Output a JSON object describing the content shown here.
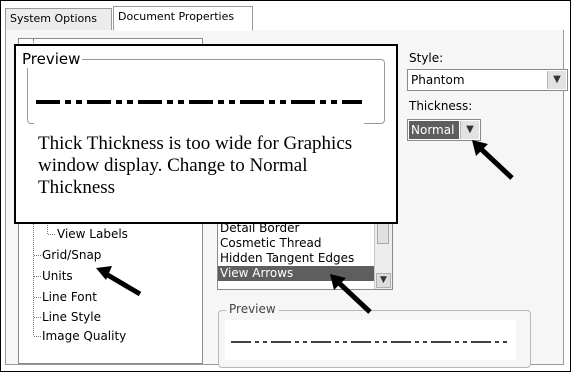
{
  "tabs": {
    "system_options": "System Options",
    "document_properties": "Document Properties"
  },
  "tree": {
    "items": [
      "View Labels",
      "Grid/Snap",
      "Units",
      "Line Font",
      "Line Style",
      "Image Quality"
    ]
  },
  "style": {
    "label": "Style:",
    "value": "Phantom"
  },
  "thickness": {
    "label": "Thickness:",
    "value": "Normal"
  },
  "line_types": {
    "items": [
      "Detail Border",
      "Cosmetic Thread",
      "Hidden Tangent Edges",
      "View Arrows"
    ],
    "selected": "View Arrows"
  },
  "preview_label": "Preview",
  "callout": {
    "title": "Preview",
    "text": "Thick Thickness is too wide for Graphics window display.  Change to Normal Thickness"
  },
  "colors": {
    "selection": "#5e5e5e",
    "frame": "#000000"
  }
}
